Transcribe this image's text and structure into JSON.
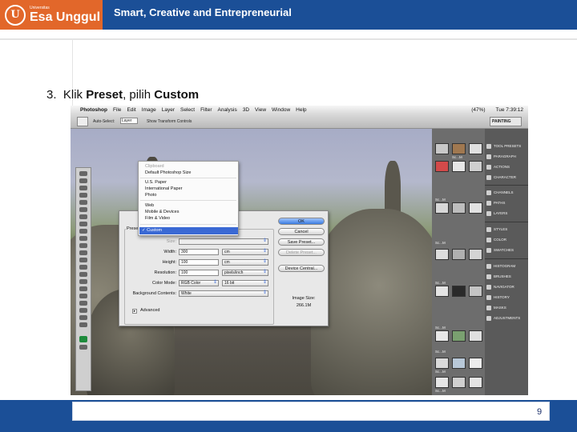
{
  "header": {
    "logo_letter": "U",
    "logo_small": "Universitas",
    "logo_name": "Esa Unggul",
    "tagline": "Smart, Creative and Entrepreneurial"
  },
  "step": {
    "number": "3.",
    "prefix": "Klik ",
    "preset_word": "Preset",
    "middle": ", pilih ",
    "custom_word": "Custom"
  },
  "photoshop": {
    "menu": [
      "Photoshop",
      "File",
      "Edit",
      "Image",
      "Layer",
      "Select",
      "Filter",
      "Analysis",
      "3D",
      "View",
      "Window",
      "Help"
    ],
    "clock": "Tue 7:39:12",
    "battery": "(47%)",
    "options": {
      "auto_select": "Auto-Select:",
      "layer": "Layer",
      "transform": "Show Transform Controls"
    },
    "workspace": "PAINTING",
    "dropdown": {
      "items_disabled": [
        "Clipboard"
      ],
      "items": [
        "Default Photoshop Size",
        "U.S. Paper",
        "International Paper",
        "Photo",
        "Web",
        "Mobile & Devices",
        "Film & Video"
      ],
      "selected": "Custom"
    },
    "dialog": {
      "preset_label": "Preset:",
      "size_label": "Size:",
      "width_label": "Width:",
      "width_value": "300",
      "width_unit": "cm",
      "height_label": "Height:",
      "height_value": "100",
      "height_unit": "cm",
      "resolution_label": "Resolution:",
      "resolution_value": "100",
      "resolution_unit": "pixels/inch",
      "color_mode_label": "Color Mode:",
      "color_mode_value": "RGB Color",
      "color_bits": "16 bit",
      "background_label": "Background Contents:",
      "background_value": "White",
      "advanced": "Advanced",
      "buttons": {
        "ok": "OK",
        "cancel": "Cancel",
        "save_preset": "Save Preset...",
        "delete_preset": "Delete Preset...",
        "device_central": "Device Central..."
      },
      "image_size_label": "Image Size:",
      "image_size_value": "266.1M"
    },
    "swatch_labels": [
      "Sc...M",
      "Sc...M",
      "Sc...M",
      "Sc...M",
      "Sc...M",
      "Sc...M",
      "Sc...M",
      "Sc...M",
      "Sc...M",
      "Sc...M"
    ],
    "panels": [
      [
        "TOOL PRESETS",
        "PARAGRAPH",
        "ACTIONS",
        "CHARACTER"
      ],
      [
        "CHANNELS",
        "PATHS",
        "LAYERS"
      ],
      [
        "STYLES",
        "COLOR",
        "SWATCHES"
      ],
      [
        "HISTOGRAM",
        "BRUSHES",
        "NAVIGATOR",
        "HISTORY",
        "MASKS",
        "ADJUSTMENTS"
      ]
    ]
  },
  "footer": {
    "page_number": "9"
  }
}
